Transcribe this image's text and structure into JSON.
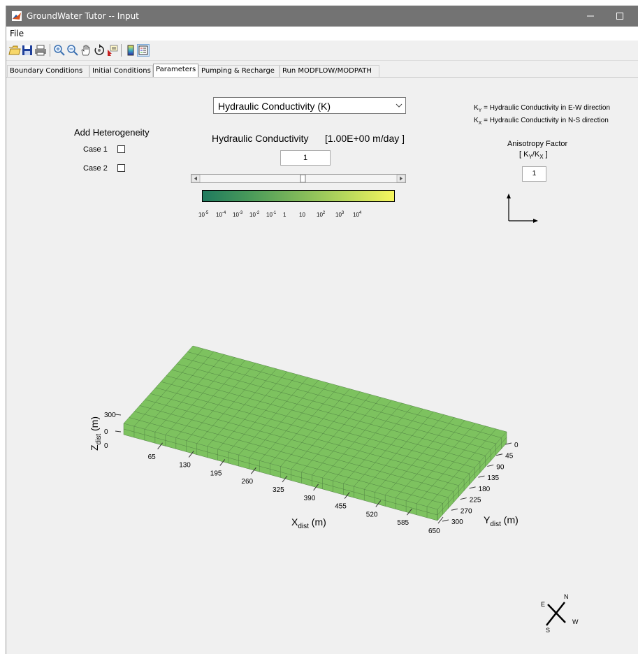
{
  "window": {
    "title": "GroundWater Tutor -- Input"
  },
  "menu": {
    "file": "File"
  },
  "toolbar": {
    "buttons": [
      "open-icon",
      "save-icon",
      "print-icon",
      "zoom-in-icon",
      "zoom-out-icon",
      "pan-icon",
      "rotate-icon",
      "data-cursor-icon",
      "colorbar-icon",
      "legend-icon"
    ]
  },
  "tabs": [
    "Boundary Conditions",
    "Initial Conditions",
    "Parameters",
    "Pumping & Recharge",
    "Run MODFLOW/MODPATH"
  ],
  "active_tab": "Parameters",
  "heterogeneity": {
    "title": "Add Heterogeneity",
    "case1": "Case 1",
    "case2": "Case 2"
  },
  "parameter_select": {
    "selected": "Hydraulic Conductivity (K)"
  },
  "conductivity": {
    "label": "Hydraulic Conductivity",
    "display": "[1.00E+00 m/day ]",
    "value": "1"
  },
  "colorbar": {
    "bases": [
      "10",
      "10",
      "10",
      "10",
      "10",
      "1",
      "10",
      "10",
      "10",
      "10"
    ],
    "exps": [
      "-5",
      "-4",
      "-3",
      "-2",
      "-1",
      "",
      "",
      "2",
      "3",
      "4"
    ],
    "colors": [
      "#1f7a5e",
      "#4a9a5a",
      "#7fb85a",
      "#b8d85c",
      "#f6f65e"
    ]
  },
  "legend": {
    "ky_sub": "Y",
    "ky_text": "= Hydraulic Conductivity in E-W direction",
    "kx_sub": "X",
    "kx_text": "= Hydraulic Conductivity in N-S direction",
    "k": "K"
  },
  "anisotropy": {
    "title": "Anisotropy Factor",
    "open": "[ K",
    "sub1": "Y",
    "slash": "/K",
    "sub2": "X",
    "close": " ]",
    "value": "1"
  },
  "chart_data": {
    "type": "surface-3d",
    "x_label": "X",
    "x_sub": "dist",
    "x_unit": "(m)",
    "y_label": "Y",
    "y_sub": "dist",
    "y_unit": "(m)",
    "z_label": "Z",
    "z_sub": "dist",
    "z_unit": "(m)",
    "x_ticks": [
      "65",
      "130",
      "195",
      "260",
      "325",
      "390",
      "455",
      "520",
      "585",
      "650"
    ],
    "y_ticks": [
      "0",
      "45",
      "90",
      "135",
      "180",
      "225",
      "270",
      "300"
    ],
    "z_ticks": [
      "300",
      "0",
      "0"
    ],
    "surface_color": "#7dc25f"
  },
  "compass": {
    "n": "N",
    "e": "E",
    "s": "S",
    "w": "W"
  }
}
